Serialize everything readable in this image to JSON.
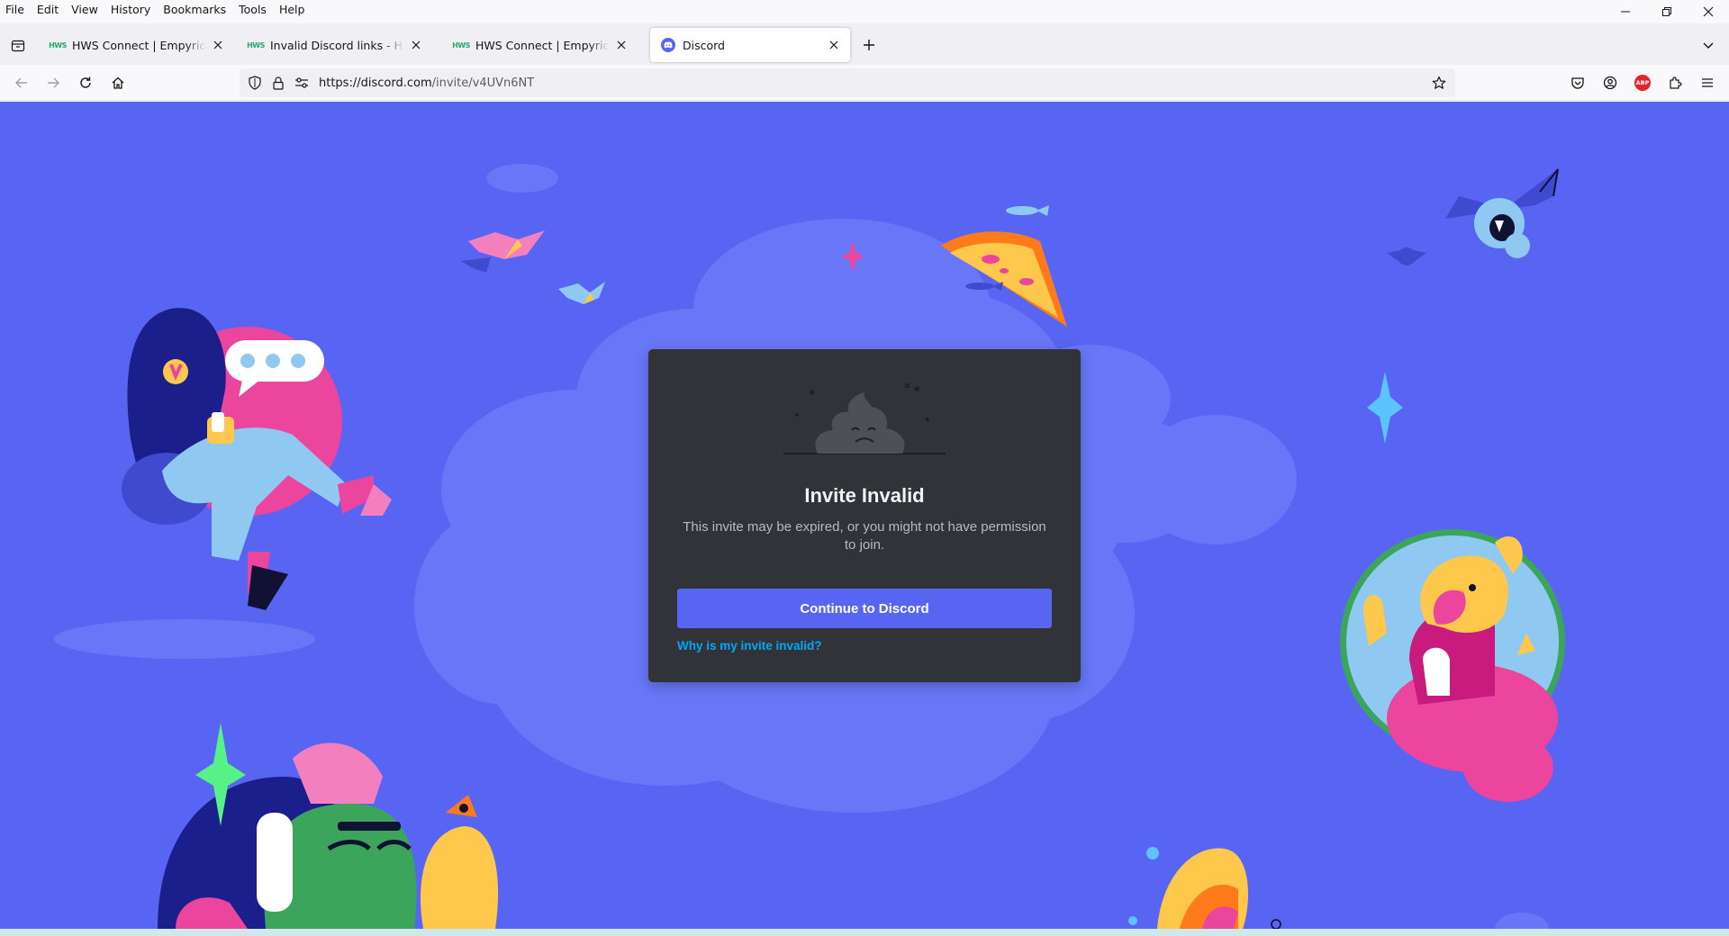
{
  "menubar": {
    "items": [
      "File",
      "Edit",
      "View",
      "History",
      "Bookmarks",
      "Tools",
      "Help"
    ]
  },
  "tabs": [
    {
      "title": "HWS Connect | Empyrion Hom",
      "icon": "hws-icon",
      "active": false
    },
    {
      "title": "Invalid Discord links - HWS Ge",
      "icon": "hws-icon",
      "active": false
    },
    {
      "title": "HWS Connect | Empyrion Hom",
      "icon": "hws-icon",
      "active": false
    },
    {
      "title": "Discord",
      "icon": "discord-icon",
      "active": true
    }
  ],
  "urlbar": {
    "host": "https://discord.com",
    "path": "/invite/v4UVn6NT"
  },
  "toolbar": {
    "abp_label": "ABP"
  },
  "card": {
    "title": "Invite Invalid",
    "description": "This invite may be expired, or you might not have permission to join.",
    "continue_label": "Continue to Discord",
    "help_link": "Why is my invite invalid?"
  },
  "colors": {
    "page_background": "#5865f2",
    "card_background": "#313338",
    "button": "#5865f2",
    "link": "#00a8fc"
  }
}
